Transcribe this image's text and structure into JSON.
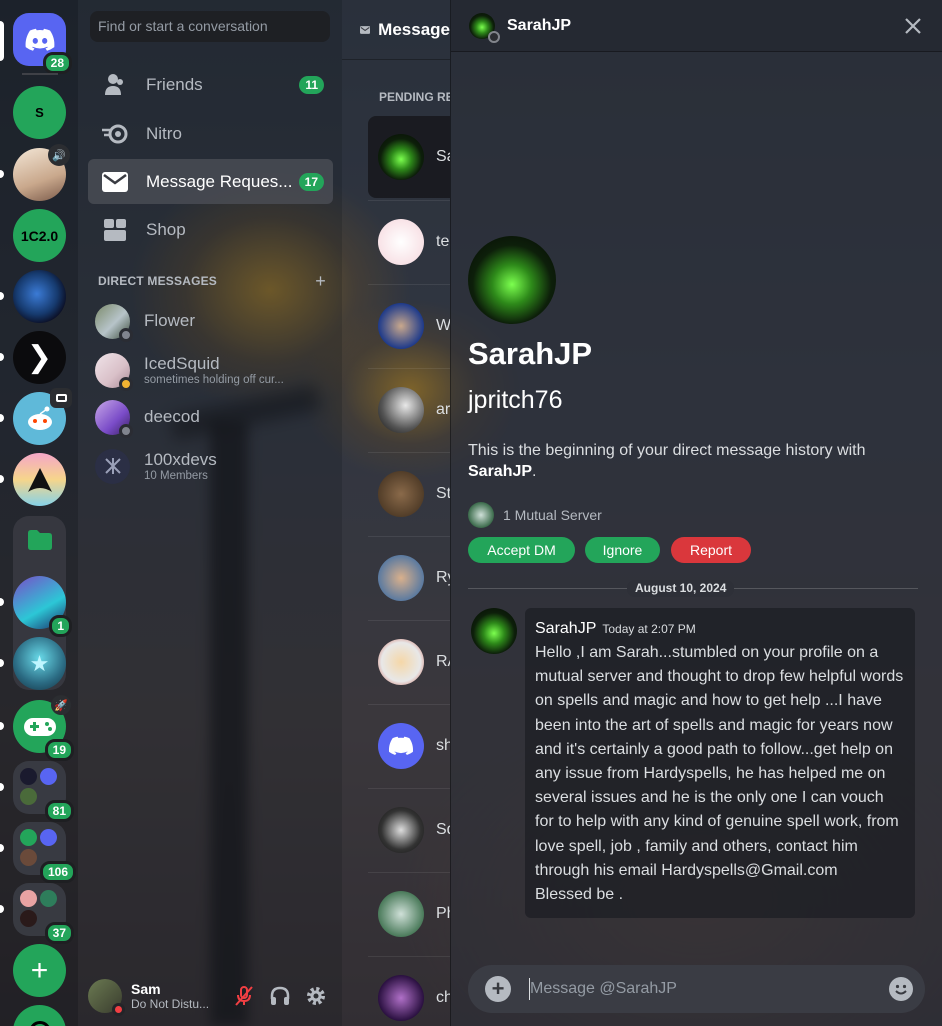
{
  "servers": {
    "home_badge": "28",
    "s_label": "S",
    "c2_label": "1C2.0",
    "folder_badge": "1",
    "server_badge_19": "19",
    "server_badge_81": "81",
    "server_badge_106": "106",
    "server_badge_37": "37",
    "add_label": "+"
  },
  "sidebar": {
    "search_placeholder": "Find or start a conversation",
    "friends_label": "Friends",
    "friends_badge": "11",
    "nitro_label": "Nitro",
    "requests_label": "Message Reques...",
    "requests_badge": "17",
    "shop_label": "Shop",
    "dm_header": "DIRECT MESSAGES",
    "dm_add": "+",
    "dms": [
      {
        "name": "Flower",
        "sub": ""
      },
      {
        "name": "IcedSquid",
        "sub": "sometimes holding off cur..."
      },
      {
        "name": "deecod",
        "sub": ""
      },
      {
        "name": "100xdevs",
        "sub": "10 Members"
      }
    ],
    "user": {
      "name": "Sam",
      "status": "Do Not Distu..."
    }
  },
  "middle": {
    "title": "Message",
    "pending": "PENDING RE",
    "requests": [
      "Sa",
      "te",
      "Wi",
      "ar",
      "St",
      "Ry",
      "RA",
      "sh",
      "Sq",
      "Ph",
      "ch"
    ]
  },
  "dm_panel": {
    "header_name": "SarahJP",
    "profile_name": "SarahJP",
    "username": "jpritch76",
    "intro_text": "This is the beginning of your direct message history with ",
    "intro_name": "SarahJP",
    "intro_end": ".",
    "mutual": "1 Mutual Server",
    "accept_label": "Accept DM",
    "ignore_label": "Ignore",
    "report_label": "Report",
    "date": "August 10, 2024",
    "message": {
      "author": "SarahJP",
      "time": "Today at 2:07 PM",
      "body": "Hello ,I am Sarah...stumbled on your profile on a mutual server and thought to drop few helpful words on spells and magic and how to get help ...I have been into the art of spells and magic for years now and it's certainly a good path to follow...get help on any issue from Hardyspells, he has helped me on several issues and he is the only one I can vouch for to help with any kind of genuine spell work, from love spell, job , family and others, contact him through his email Hardyspells@Gmail.com   Blessed be ."
    },
    "composer_placeholder": "Message @SarahJP"
  },
  "colors": {
    "accept": "#23a55a",
    "ignore": "#23a55a",
    "report": "#da373c",
    "blurple": "#5865f2",
    "badge_green": "#23a55a"
  }
}
